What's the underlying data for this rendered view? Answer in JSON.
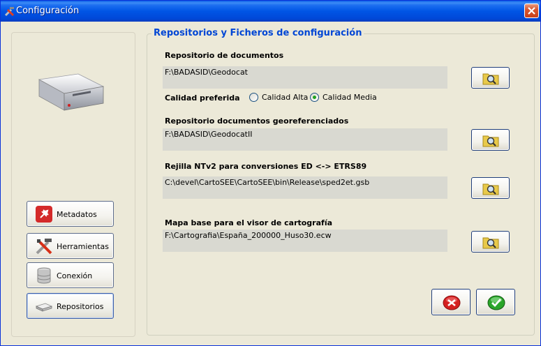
{
  "window": {
    "title": "Configuración"
  },
  "sidebar": {
    "items": [
      {
        "label": "Metadatos",
        "icon": "pushpin-icon"
      },
      {
        "label": "Herramientas",
        "icon": "tools-icon"
      },
      {
        "label": "Conexión",
        "icon": "database-icon"
      },
      {
        "label": "Repositorios",
        "icon": "drive-icon"
      }
    ]
  },
  "group": {
    "title": "Repositorios y Ficheros de configuración"
  },
  "fields": [
    {
      "label": "Repositorio de documentos",
      "value": "F:\\BADASID\\Geodocat"
    },
    {
      "label": "Repositorio documentos georeferenciados",
      "value": "F:\\BADASID\\GeodocatII"
    },
    {
      "label": "Rejilla NTv2 para conversiones ED <-> ETRS89",
      "value": "C:\\devel\\CartoSEE\\CartoSEE\\bin\\Release\\sped2et.gsb"
    },
    {
      "label": "Mapa base para el visor de cartografía",
      "value": "F:\\Cartografia\\España_200000_Huso30.ecw"
    }
  ],
  "quality": {
    "label": "Calidad preferida",
    "options": [
      {
        "label": "Calidad Alta",
        "selected": false
      },
      {
        "label": "Calidad Media",
        "selected": true
      }
    ]
  },
  "colors": {
    "accent": "#0046d5",
    "titlebar": "#0055e5",
    "cancel": "#d42020",
    "ok": "#2aa52a"
  }
}
